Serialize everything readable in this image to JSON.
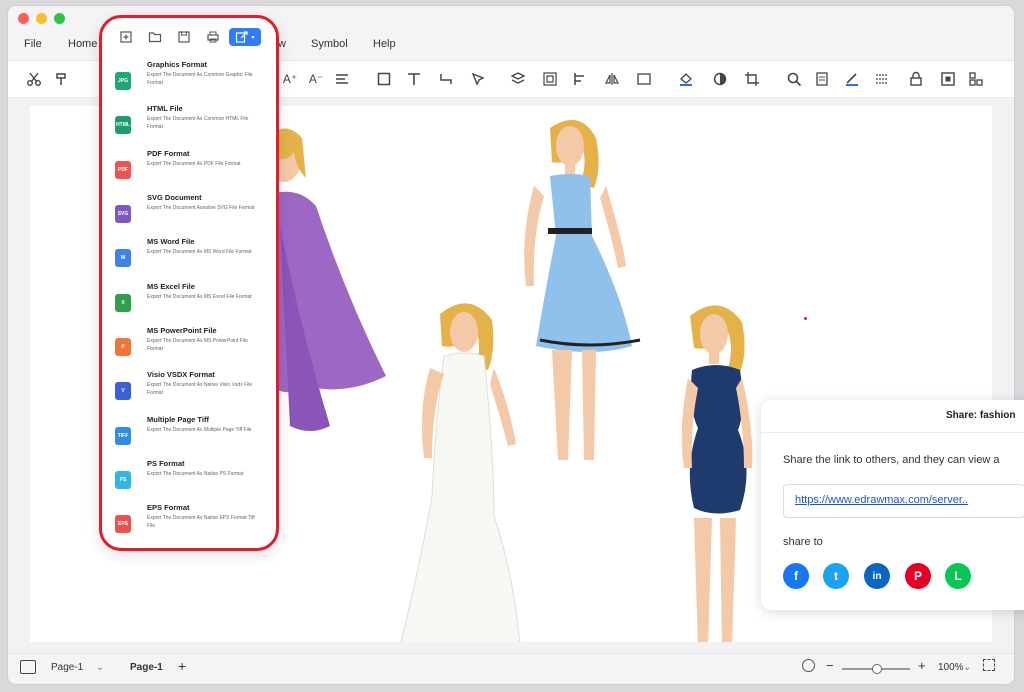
{
  "window": {
    "traffic_colors": [
      "#fe5f57",
      "#febc2e",
      "#28c840"
    ]
  },
  "menu": {
    "file": "File",
    "home": "Home",
    "view_tail": "w",
    "symbol": "Symbol",
    "help": "Help"
  },
  "export_menu": {
    "toolbar_icons": [
      "new-page-icon",
      "open-folder-icon",
      "save-icon",
      "print-icon",
      "export-icon"
    ],
    "items": [
      {
        "title": "Graphics Format",
        "desc": "Export The Document As Common Graphic File Format",
        "badge": "JPG",
        "color": "#1fa67a"
      },
      {
        "title": "HTML File",
        "desc": "Export The Document As Common HTML File Format",
        "badge": "HTML",
        "color": "#1e9e6e"
      },
      {
        "title": "PDF Format",
        "desc": "Export The Document As PDF File Format",
        "badge": "PDF",
        "color": "#ef5350"
      },
      {
        "title": "SVG Document",
        "desc": "Export The Document Asnative SVG File Format",
        "badge": "SVG",
        "color": "#7e57c2"
      },
      {
        "title": "MS Word File",
        "desc": "Export The Document As MS Word File Format",
        "badge": "W",
        "color": "#3f82e8"
      },
      {
        "title": "MS Excel File",
        "desc": "Export The Document As MS Excel File Format",
        "badge": "X",
        "color": "#2e9e4f"
      },
      {
        "title": "MS PowerPoint File",
        "desc": "Export The Document As MS PowerPoint File Format",
        "badge": "P",
        "color": "#f07537"
      },
      {
        "title": "Visio VSDX Format",
        "desc": "Export The Document As Native Visio Vsdx File Format",
        "badge": "V",
        "color": "#3b5fd8"
      },
      {
        "title": "Multiple Page Tiff",
        "desc": "Export The Document As Multiple Page Tiff File",
        "badge": "TIFF",
        "color": "#2e8fe0"
      },
      {
        "title": "PS Format",
        "desc": "Export The Document As Native PS Format",
        "badge": "PS",
        "color": "#33b5e5"
      },
      {
        "title": "EPS Format",
        "desc": "Export The Document As Native EPS Format Tiff File",
        "badge": "EPS",
        "color": "#e55353"
      }
    ]
  },
  "share": {
    "title": "Share: fashion",
    "description": "Share the link to others, and they can view a",
    "link": "https://www.edrawmax.com/server..",
    "share_to": "share to",
    "socials": [
      {
        "name": "facebook-icon",
        "glyph": "f",
        "color": "#1877f2"
      },
      {
        "name": "twitter-icon",
        "glyph": "t",
        "color": "#1da1f2"
      },
      {
        "name": "linkedin-icon",
        "glyph": "in",
        "color": "#0a66c2"
      },
      {
        "name": "pinterest-icon",
        "glyph": "P",
        "color": "#e60023"
      },
      {
        "name": "line-icon",
        "glyph": "L",
        "color": "#06c755"
      }
    ]
  },
  "status": {
    "page_select": "Page-1",
    "page_tab": "Page-1",
    "add": "+",
    "zoom_minus": "−",
    "zoom_plus": "+",
    "zoom": "100%"
  }
}
